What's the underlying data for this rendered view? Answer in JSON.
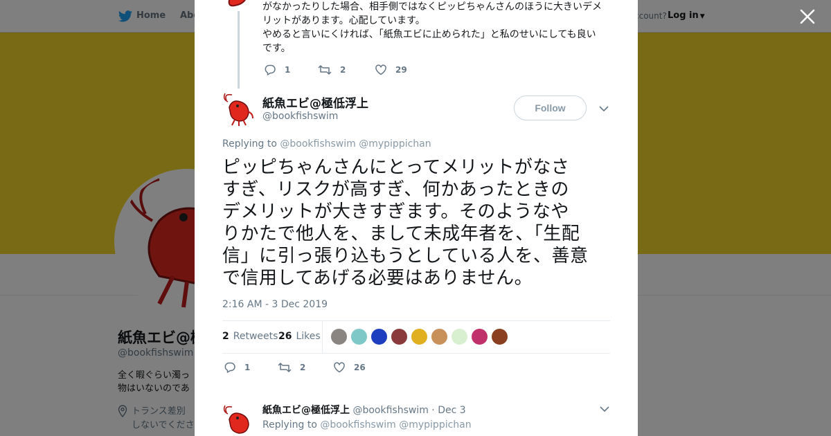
{
  "topbar": {
    "home_label": "Home",
    "about_label": "Abo",
    "account_prompt": "ccount?",
    "login_label": "Log in"
  },
  "profile": {
    "name": "紙魚エビ@極",
    "handle": "@bookfishswim",
    "bio_line1": "全く暇ぐらい濁っ",
    "bio_line2": "物はいないのであ",
    "location_line1": "トランス差別",
    "location_line2": "しないでくださ"
  },
  "modal": {
    "close_icon": "close-icon",
    "previous_tweet": {
      "lines": [
        "がなかったりした場合、相手側ではなくピッピちゃんさんのほうに大きいデメ",
        "リットがあります。心配しています。",
        "やめると言いにくければ、「紙魚エビに止められた」と私のせいにしても良い",
        "です。"
      ],
      "reply_count": "1",
      "retweet_count": "2",
      "like_count": "29"
    },
    "main_tweet": {
      "author_name": "紙魚エビ@極低浮上",
      "author_handle": "@bookfishswim",
      "follow_label": "Follow",
      "replying_prefix": "Replying to",
      "replying_to_1": "@bookfishswim",
      "replying_to_2": "@mypippichan",
      "text_lines": [
        "ピッピちゃんさんにとってメリットがなさ",
        "すぎ、リスクが高すぎ、何かあったときの",
        "デメリットが大きすぎます。そのようなや",
        "りかたで他人を、まして未成年者を、「生配",
        "信」に引っ張り込もうとしている人を、善意",
        "で信用してあげる必要はありません。"
      ],
      "timestamp": "2:16 AM - 3 Dec 2019",
      "retweets_count": "2",
      "retweets_label": "Retweets",
      "likes_count": "26",
      "likes_label": "Likes",
      "liker_colors": [
        "#8a8580",
        "#7ec8c8",
        "#1d3fbf",
        "#8a3a3a",
        "#e0b020",
        "#c8905a",
        "#d8f0d0",
        "#c0306a",
        "#8a4020"
      ],
      "reply_count": "1",
      "retweet_count": "2",
      "like_count": "26"
    },
    "next_tweet": {
      "author_name": "紙魚エビ@極低浮上",
      "author_handle": "@bookfishswim",
      "date": "· Dec 3",
      "replying_prefix": "Replying to",
      "replying_to_1": "@bookfishswim",
      "replying_to_2": "@mypippichan"
    }
  }
}
